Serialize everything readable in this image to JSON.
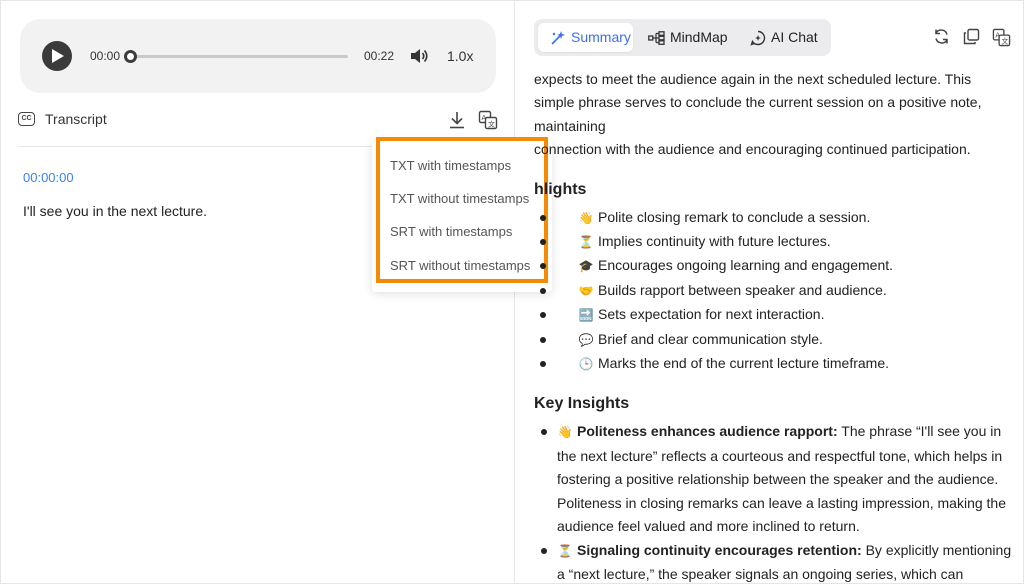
{
  "player": {
    "current_time": "00:00",
    "duration": "00:22",
    "speed": "1.0x",
    "progress": 0
  },
  "transcript": {
    "title": "Transcript",
    "cc_label": "CC",
    "entries": [
      {
        "timestamp": "00:00:00",
        "text": "I'll see you in the next lecture."
      }
    ]
  },
  "download_menu": {
    "items": [
      "TXT with timestamps",
      "TXT without timestamps",
      "SRT with timestamps",
      "SRT without timestamps"
    ]
  },
  "tabs": [
    {
      "label": "Summary",
      "icon": "sparkle-wand-icon",
      "active": true
    },
    {
      "label": "MindMap",
      "icon": "mindmap-icon",
      "active": false
    },
    {
      "label": "AI Chat",
      "icon": "ai-chat-icon",
      "active": false
    }
  ],
  "summary": {
    "intro_partial": "expects to meet the audience again in the next scheduled lecture. This simple phrase serves to conclude the current session on a positive note, maintaining",
    "intro_line3": "connection with the audience and encouraging continued participation.",
    "highlights_title": "hlights",
    "highlights": [
      {
        "emoji": "👋",
        "text": "Polite closing remark to conclude a session."
      },
      {
        "emoji": "⏳",
        "text": "Implies continuity with future lectures."
      },
      {
        "emoji": "🎓",
        "text": "Encourages ongoing learning and engagement."
      },
      {
        "emoji": "🤝",
        "text": "Builds rapport between speaker and audience."
      },
      {
        "emoji": "🔜",
        "text": "Sets expectation for next interaction."
      },
      {
        "emoji": "💬",
        "text": "Brief and clear communication style."
      },
      {
        "emoji": "🕒",
        "text": "Marks the end of the current lecture timeframe."
      }
    ],
    "insights_title": "Key Insights",
    "insights": [
      {
        "emoji": "👋",
        "title": "Politeness enhances audience rapport:",
        "text": "The phrase “I'll see you in the next lecture” reflects a courteous and respectful tone, which helps in fostering a positive relationship between the speaker and the audience. Politeness in closing remarks can leave a lasting impression, making the audience feel valued and more inclined to return."
      },
      {
        "emoji": "⏳",
        "title": "Signaling continuity encourages retention:",
        "text": "By explicitly mentioning a “next lecture,” the speaker signals an ongoing series, which can motivate"
      }
    ]
  },
  "colors": {
    "accent_blue": "#3b6ef5",
    "timestamp_blue": "#3b82f6",
    "highlight_orange": "#f58a07",
    "player_bg": "#f2f2f3"
  }
}
